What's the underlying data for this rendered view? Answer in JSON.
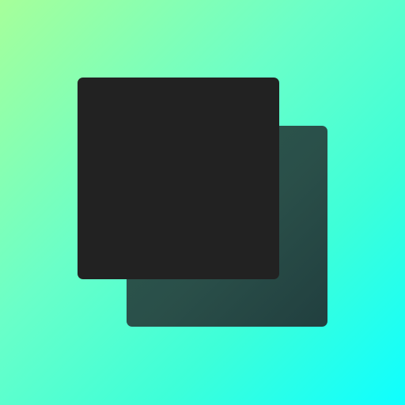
{
  "icon": {
    "name": "stacked-squares-icon",
    "colors": {
      "background_start": "#a6ff9a",
      "background_end": "#0effff",
      "back_square": "#2a4f49",
      "front_square": "#222222"
    }
  }
}
